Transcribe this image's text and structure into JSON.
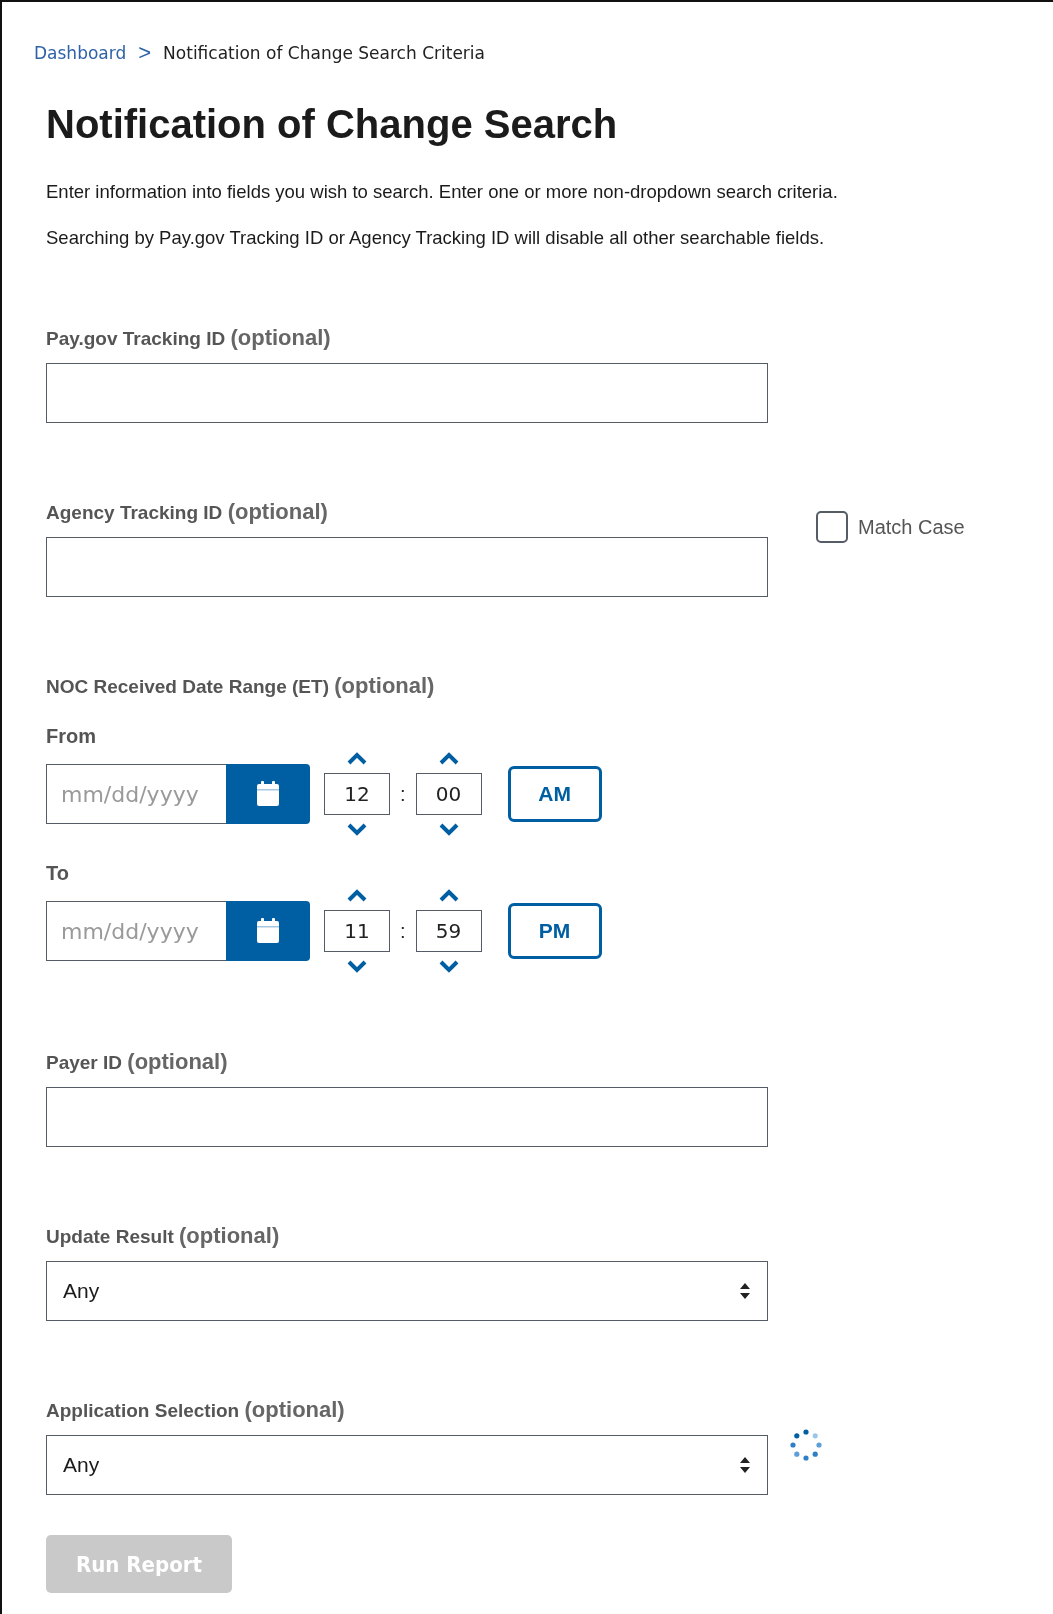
{
  "breadcrumb": {
    "link": "Dashboard",
    "separator": ">",
    "current": "Notification of Change Search Criteria"
  },
  "title": "Notification of Change Search",
  "instructions": [
    "Enter information into fields you wish to search. Enter one or more non-dropdown search criteria.",
    "Searching by Pay.gov Tracking ID or Agency Tracking ID will disable all other searchable fields."
  ],
  "fields": [
    {
      "kind": "text",
      "label": "Pay.gov Tracking ID",
      "hint": "(optional)"
    },
    {
      "kind": "text",
      "label": "Agency Tracking ID",
      "hint": "(optional)",
      "match_case": {
        "label": "Match Case",
        "checked": false
      }
    },
    {
      "kind": "date_range",
      "label": "NOC Received Date Range (ET)",
      "hint": "(optional)",
      "ends": [
        {
          "label": "From",
          "placeholder": "mm/dd/yyyy",
          "hour": "12",
          "separator": ":",
          "minute": "00",
          "period": "AM"
        },
        {
          "label": "To",
          "placeholder": "mm/dd/yyyy",
          "hour": "11",
          "separator": ":",
          "minute": "59",
          "period": "PM"
        }
      ]
    },
    {
      "kind": "text",
      "label": "Payer ID",
      "hint": "(optional)"
    },
    {
      "kind": "select",
      "label": "Update Result",
      "hint": "(optional)",
      "value": "Any"
    },
    {
      "kind": "select",
      "label": "Application Selection",
      "hint": "(optional)",
      "value": "Any",
      "loading": true
    }
  ],
  "run_button": {
    "label": "Run Report",
    "disabled": true
  }
}
